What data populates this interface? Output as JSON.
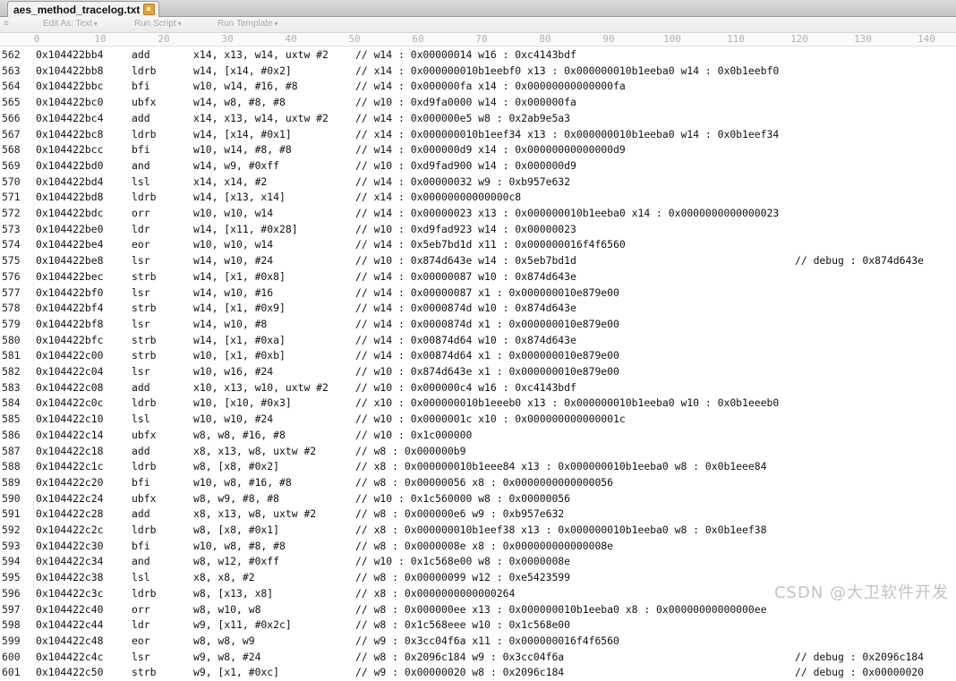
{
  "tab": {
    "title": "aes_method_tracelog.txt"
  },
  "toolbar": {
    "edit_as": "Edit As: Text",
    "run_script": "Run Script",
    "run_template": "Run Template"
  },
  "ruler": [
    "0",
    "10",
    "20",
    "30",
    "40",
    "50",
    "60",
    "70",
    "80",
    "90",
    "100",
    "110",
    "120",
    "130",
    "140"
  ],
  "rows": [
    {
      "ln": "562",
      "addr": "0x104422bb4",
      "op": "add",
      "args": "x14, x13, w14, uxtw #2",
      "cmt": "// w14 : 0x00000014 w16 : 0xc4143bdf",
      "dbg": ""
    },
    {
      "ln": "563",
      "addr": "0x104422bb8",
      "op": "ldrb",
      "args": "w14, [x14, #0x2]",
      "cmt": "// x14 : 0x000000010b1eebf0 x13 : 0x000000010b1eeba0 w14 : 0x0b1eebf0",
      "dbg": ""
    },
    {
      "ln": "564",
      "addr": "0x104422bbc",
      "op": "bfi",
      "args": "w10, w14, #16, #8",
      "cmt": "// w14 : 0x000000fa x14 : 0x00000000000000fa",
      "dbg": ""
    },
    {
      "ln": "565",
      "addr": "0x104422bc0",
      "op": "ubfx",
      "args": "w14, w8, #8, #8",
      "cmt": "// w10 : 0xd9fa0000 w14 : 0x000000fa",
      "dbg": ""
    },
    {
      "ln": "566",
      "addr": "0x104422bc4",
      "op": "add",
      "args": "x14, x13, w14, uxtw #2",
      "cmt": "// w14 : 0x000000e5 w8 : 0x2ab9e5a3",
      "dbg": ""
    },
    {
      "ln": "567",
      "addr": "0x104422bc8",
      "op": "ldrb",
      "args": "w14, [x14, #0x1]",
      "cmt": "// x14 : 0x000000010b1eef34 x13 : 0x000000010b1eeba0 w14 : 0x0b1eef34",
      "dbg": ""
    },
    {
      "ln": "568",
      "addr": "0x104422bcc",
      "op": "bfi",
      "args": "w10, w14, #8, #8",
      "cmt": "// w14 : 0x000000d9 x14 : 0x00000000000000d9",
      "dbg": ""
    },
    {
      "ln": "569",
      "addr": "0x104422bd0",
      "op": "and",
      "args": "w14, w9, #0xff",
      "cmt": "// w10 : 0xd9fad900 w14 : 0x000000d9",
      "dbg": ""
    },
    {
      "ln": "570",
      "addr": "0x104422bd4",
      "op": "lsl",
      "args": "x14, x14, #2",
      "cmt": "// w14 : 0x00000032 w9 : 0xb957e632",
      "dbg": ""
    },
    {
      "ln": "571",
      "addr": "0x104422bd8",
      "op": "ldrb",
      "args": "w14, [x13, x14]",
      "cmt": "// x14 : 0x00000000000000c8",
      "dbg": ""
    },
    {
      "ln": "572",
      "addr": "0x104422bdc",
      "op": "orr",
      "args": "w10, w10, w14",
      "cmt": "// w14 : 0x00000023 x13 : 0x000000010b1eeba0 x14 : 0x0000000000000023",
      "dbg": ""
    },
    {
      "ln": "573",
      "addr": "0x104422be0",
      "op": "ldr",
      "args": "w14, [x11, #0x28]",
      "cmt": "// w10 : 0xd9fad923 w14 : 0x00000023",
      "dbg": ""
    },
    {
      "ln": "574",
      "addr": "0x104422be4",
      "op": "eor",
      "args": "w10, w10, w14",
      "cmt": "// w14 : 0x5eb7bd1d x11 : 0x000000016f4f6560",
      "dbg": ""
    },
    {
      "ln": "575",
      "addr": "0x104422be8",
      "op": "lsr",
      "args": "w14, w10, #24",
      "cmt": "// w10 : 0x874d643e w14 : 0x5eb7bd1d",
      "dbg": "// debug : 0x874d643e"
    },
    {
      "ln": "576",
      "addr": "0x104422bec",
      "op": "strb",
      "args": "w14, [x1, #0x8]",
      "cmt": "// w14 : 0x00000087 w10 : 0x874d643e",
      "dbg": ""
    },
    {
      "ln": "577",
      "addr": "0x104422bf0",
      "op": "lsr",
      "args": "w14, w10, #16",
      "cmt": "// w14 : 0x00000087 x1 : 0x000000010e879e00",
      "dbg": ""
    },
    {
      "ln": "578",
      "addr": "0x104422bf4",
      "op": "strb",
      "args": "w14, [x1, #0x9]",
      "cmt": "// w14 : 0x0000874d w10 : 0x874d643e",
      "dbg": ""
    },
    {
      "ln": "579",
      "addr": "0x104422bf8",
      "op": "lsr",
      "args": "w14, w10, #8",
      "cmt": "// w14 : 0x0000874d x1 : 0x000000010e879e00",
      "dbg": ""
    },
    {
      "ln": "580",
      "addr": "0x104422bfc",
      "op": "strb",
      "args": "w14, [x1, #0xa]",
      "cmt": "// w14 : 0x00874d64 w10 : 0x874d643e",
      "dbg": ""
    },
    {
      "ln": "581",
      "addr": "0x104422c00",
      "op": "strb",
      "args": "w10, [x1, #0xb]",
      "cmt": "// w14 : 0x00874d64 x1 : 0x000000010e879e00",
      "dbg": ""
    },
    {
      "ln": "582",
      "addr": "0x104422c04",
      "op": "lsr",
      "args": "w10, w16, #24",
      "cmt": "// w10 : 0x874d643e x1 : 0x000000010e879e00",
      "dbg": ""
    },
    {
      "ln": "583",
      "addr": "0x104422c08",
      "op": "add",
      "args": "x10, x13, w10, uxtw #2",
      "cmt": "// w10 : 0x000000c4 w16 : 0xc4143bdf",
      "dbg": ""
    },
    {
      "ln": "584",
      "addr": "0x104422c0c",
      "op": "ldrb",
      "args": "w10, [x10, #0x3]",
      "cmt": "// x10 : 0x000000010b1eeeb0 x13 : 0x000000010b1eeba0 w10 : 0x0b1eeeb0",
      "dbg": ""
    },
    {
      "ln": "585",
      "addr": "0x104422c10",
      "op": "lsl",
      "args": "w10, w10, #24",
      "cmt": "// w10 : 0x0000001c x10 : 0x000000000000001c",
      "dbg": ""
    },
    {
      "ln": "586",
      "addr": "0x104422c14",
      "op": "ubfx",
      "args": "w8, w8, #16, #8",
      "cmt": "// w10 : 0x1c000000",
      "dbg": ""
    },
    {
      "ln": "587",
      "addr": "0x104422c18",
      "op": "add",
      "args": "x8, x13, w8, uxtw #2",
      "cmt": "// w8 : 0x000000b9",
      "dbg": ""
    },
    {
      "ln": "588",
      "addr": "0x104422c1c",
      "op": "ldrb",
      "args": "w8, [x8, #0x2]",
      "cmt": "// x8 : 0x000000010b1eee84 x13 : 0x000000010b1eeba0 w8 : 0x0b1eee84",
      "dbg": ""
    },
    {
      "ln": "589",
      "addr": "0x104422c20",
      "op": "bfi",
      "args": "w10, w8, #16, #8",
      "cmt": "// w8 : 0x00000056 x8 : 0x0000000000000056",
      "dbg": ""
    },
    {
      "ln": "590",
      "addr": "0x104422c24",
      "op": "ubfx",
      "args": "w8, w9, #8, #8",
      "cmt": "// w10 : 0x1c560000 w8 : 0x00000056",
      "dbg": ""
    },
    {
      "ln": "591",
      "addr": "0x104422c28",
      "op": "add",
      "args": "x8, x13, w8, uxtw #2",
      "cmt": "// w8 : 0x000000e6 w9 : 0xb957e632",
      "dbg": ""
    },
    {
      "ln": "592",
      "addr": "0x104422c2c",
      "op": "ldrb",
      "args": "w8, [x8, #0x1]",
      "cmt": "// x8 : 0x000000010b1eef38 x13 : 0x000000010b1eeba0 w8 : 0x0b1eef38",
      "dbg": ""
    },
    {
      "ln": "593",
      "addr": "0x104422c30",
      "op": "bfi",
      "args": "w10, w8, #8, #8",
      "cmt": "// w8 : 0x0000008e x8 : 0x000000000000008e",
      "dbg": ""
    },
    {
      "ln": "594",
      "addr": "0x104422c34",
      "op": "and",
      "args": "w8, w12, #0xff",
      "cmt": "// w10 : 0x1c568e00 w8 : 0x0000008e",
      "dbg": ""
    },
    {
      "ln": "595",
      "addr": "0x104422c38",
      "op": "lsl",
      "args": "x8, x8, #2",
      "cmt": "// w8 : 0x00000099 w12 : 0xe5423599",
      "dbg": ""
    },
    {
      "ln": "596",
      "addr": "0x104422c3c",
      "op": "ldrb",
      "args": "w8, [x13, x8]",
      "cmt": "// x8 : 0x0000000000000264",
      "dbg": ""
    },
    {
      "ln": "597",
      "addr": "0x104422c40",
      "op": "orr",
      "args": "w8, w10, w8",
      "cmt": "// w8 : 0x000000ee x13 : 0x000000010b1eeba0 x8 : 0x00000000000000ee",
      "dbg": ""
    },
    {
      "ln": "598",
      "addr": "0x104422c44",
      "op": "ldr",
      "args": "w9, [x11, #0x2c]",
      "cmt": "// w8 : 0x1c568eee w10 : 0x1c568e00",
      "dbg": ""
    },
    {
      "ln": "599",
      "addr": "0x104422c48",
      "op": "eor",
      "args": "w8, w8, w9",
      "cmt": "// w9 : 0x3cc04f6a x11 : 0x000000016f4f6560",
      "dbg": ""
    },
    {
      "ln": "600",
      "addr": "0x104422c4c",
      "op": "lsr",
      "args": "w9, w8, #24",
      "cmt": "// w8 : 0x2096c184 w9 : 0x3cc04f6a",
      "dbg": "// debug : 0x2096c184"
    },
    {
      "ln": "601",
      "addr": "0x104422c50",
      "op": "strb",
      "args": "w9, [x1, #0xc]",
      "cmt": "// w9 : 0x00000020 w8 : 0x2096c184",
      "dbg": "// debug : 0x00000020"
    }
  ],
  "watermark": "CSDN @大卫软件开发"
}
